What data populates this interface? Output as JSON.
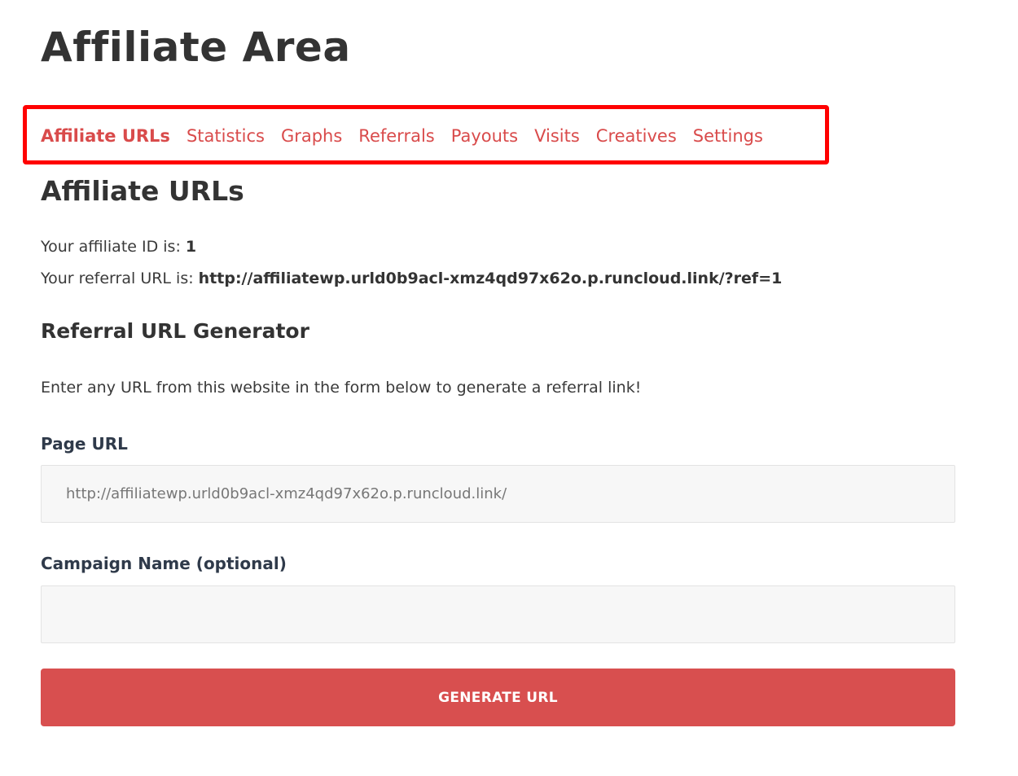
{
  "page": {
    "title": "Affiliate Area"
  },
  "tabs": [
    {
      "label": "Affiliate URLs",
      "active": true
    },
    {
      "label": "Statistics",
      "active": false
    },
    {
      "label": "Graphs",
      "active": false
    },
    {
      "label": "Referrals",
      "active": false
    },
    {
      "label": "Payouts",
      "active": false
    },
    {
      "label": "Visits",
      "active": false
    },
    {
      "label": "Creatives",
      "active": false
    },
    {
      "label": "Settings",
      "active": false
    }
  ],
  "section": {
    "title": "Affiliate URLs",
    "affiliate_id_label": "Your affiliate ID is: ",
    "affiliate_id_value": "1",
    "referral_url_label": "Your referral URL is: ",
    "referral_url_value": "http://affiliatewp.urld0b9acl-xmz4qd97x62o.p.runcloud.link/?ref=1"
  },
  "generator": {
    "title": "Referral URL Generator",
    "description": "Enter any URL from this website in the form below to generate a referral link!",
    "page_url_label": "Page URL",
    "page_url_value": "http://affiliatewp.urld0b9acl-xmz4qd97x62o.p.runcloud.link/",
    "campaign_label": "Campaign Name (optional)",
    "campaign_value": "",
    "button_label": "GENERATE URL"
  },
  "colors": {
    "accent": "#d84f4f",
    "tab_text": "#d94b4b",
    "highlight_border": "#ff0000",
    "heading": "#333333",
    "field_bg": "#f7f7f7"
  }
}
